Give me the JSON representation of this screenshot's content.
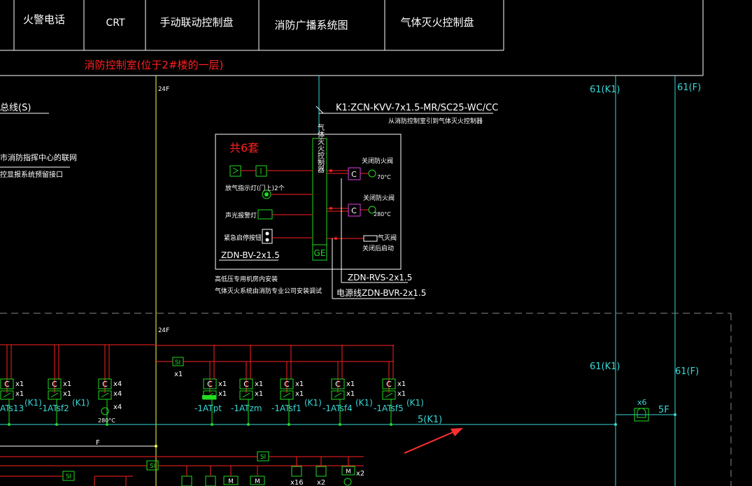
{
  "colors": {
    "background": "#000000",
    "white": "#ffffff",
    "red": "#ff2020",
    "cyan": "#38d8d8",
    "green": "#22dd22",
    "yellow": "#ffff44",
    "magenta": "#e040e0",
    "arrow": "#ff3030"
  },
  "header": {
    "cells": [
      "火警电话",
      "CRT",
      "手动联动控制盘",
      "消防广播系统图",
      "气体灭火控制盘"
    ],
    "room_label": "消防控制室(位于2#楼的一层)"
  },
  "left_labels": {
    "bus_line": "总线(S)",
    "network_1": "市消防指挥中心的联网",
    "network_2": "控显报系统预留接口"
  },
  "floor_marks": {
    "upper": "24F",
    "lower": "24F"
  },
  "cable_k1": {
    "main": "K1:ZCN-KVV-7x1.5-MR/SC25-WC/CC",
    "sub": "从消防控制室引到气体灭火控制器"
  },
  "gas_panel": {
    "title": "共6套",
    "controller": "气体灭火控制器",
    "ge": "GE",
    "labels": {
      "release_light": "放气指示灯(门上)2个",
      "alarm_light": "声光报警灯",
      "emergency": "紧急启停按钮"
    },
    "cable_bv": "ZDN-BV-2x1.5",
    "right_labels": {
      "damper_70": "关闭防火阀",
      "temp_70": "70°C",
      "damper_280": "关闭防火阀",
      "temp_280": "280°C",
      "gas_1": "气灭阀",
      "gas_2": "关闭后启动"
    },
    "cable_rvs": "ZDN-RVS-2x1.5",
    "cable_power": "电源线ZDN-BVR-2x1.5",
    "note_1": "高低压专用机房内安装",
    "note_2": "气体灭火系统由消防专业公司安装调试"
  },
  "riser": {
    "label_top": "61(K1)",
    "label_top_f": "61(F)",
    "label_mid": "61(K1)",
    "label_mid_f": "61(F)",
    "bus_label": "5(K1)"
  },
  "modules": [
    {
      "code": "x1",
      "name": "-1ATs13",
      "tag": "(K1)"
    },
    {
      "code": "x1",
      "name": "-1ATsf2",
      "tag": "(K1)"
    },
    {
      "code": "x4",
      "name": "280°C",
      "tag": "x4"
    },
    {
      "code": "x1",
      "name": "-1ATpt",
      "tag": ""
    },
    {
      "code": "x1",
      "name": "-1ATzm",
      "tag": ""
    },
    {
      "code": "x1",
      "name": "-1ATsf1",
      "tag": "(K1)"
    },
    {
      "code": "x1",
      "name": "-1ATsf4",
      "tag": "(K1)"
    },
    {
      "code": "x1",
      "name": "-1ATsf5",
      "tag": "(K1)"
    }
  ],
  "si_label": "SI",
  "si_count": "x1",
  "c_symbol": "C",
  "m_symbol": "M",
  "f_line": "F",
  "floor_device": {
    "count": "x6",
    "floor": "5F"
  },
  "bottom_counts": {
    "a": "x16",
    "b": "x2",
    "c": "x2"
  }
}
